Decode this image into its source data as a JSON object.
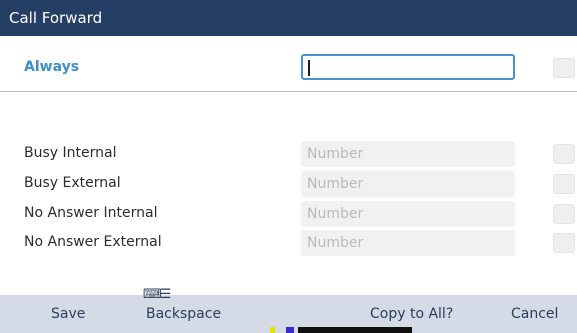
{
  "title": "Call Forward",
  "always": {
    "label": "Always",
    "value": ""
  },
  "rows": [
    {
      "label": "Busy Internal",
      "placeholder": "Number"
    },
    {
      "label": "Busy External",
      "placeholder": "Number"
    },
    {
      "label": "No Answer Internal",
      "placeholder": "Number"
    },
    {
      "label": "No Answer External",
      "placeholder": "Number"
    }
  ],
  "softkeys": {
    "save": "Save",
    "backspace": "Backspace",
    "copy_to_all": "Copy to All?",
    "cancel": "Cancel"
  },
  "colors": {
    "title_bar": "#243f63",
    "accent": "#3f8fc6",
    "softkey_bar": "#d4dbe6"
  },
  "icons": {
    "backspace": "backspace-keyboard-icon"
  }
}
